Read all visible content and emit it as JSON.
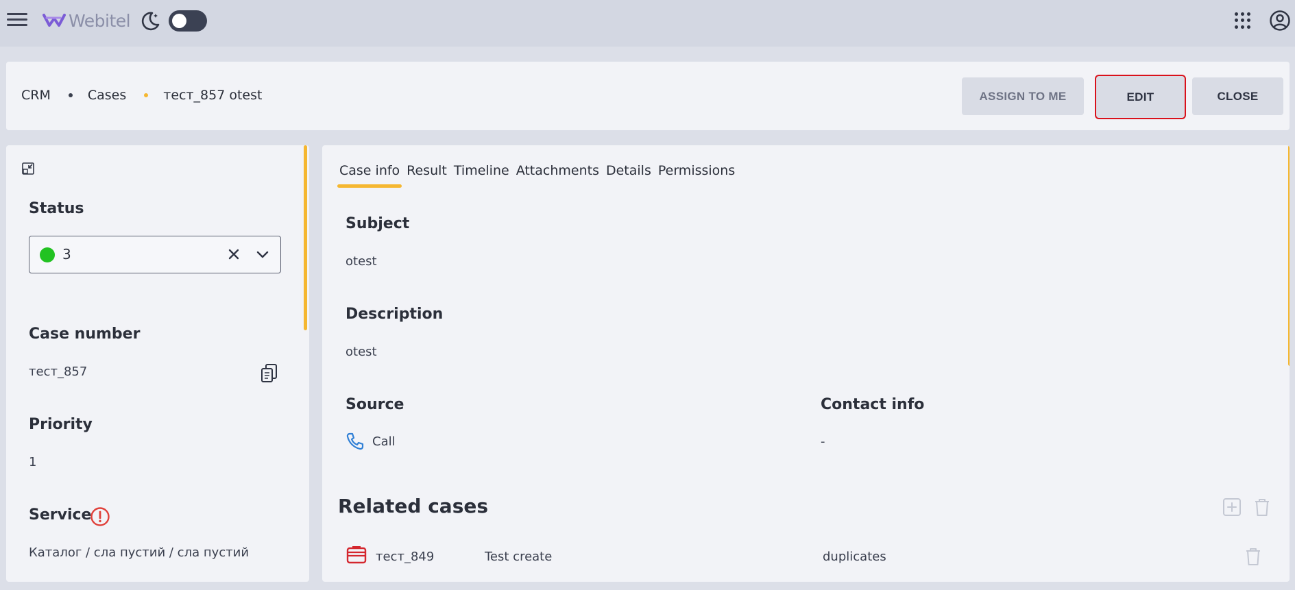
{
  "app": {
    "logo_text": "Webitel",
    "brand_color": "#7b5cd6",
    "accent_color": "#f5b731"
  },
  "header": {
    "breadcrumb": [
      "CRM",
      "Cases",
      "тест_857 otest"
    ],
    "assign_label": "ASSIGN TO ME",
    "edit_label": "EDIT",
    "close_label": "CLOSE"
  },
  "sidebar": {
    "status_label": "Status",
    "status_value": "3",
    "status_color": "#22c222",
    "case_number_label": "Case number",
    "case_number_value": "тест_857",
    "priority_label": "Priority",
    "priority_value": "1",
    "service_label": "Service",
    "service_value": "Каталог / сла пустий / сла пустий"
  },
  "main": {
    "tabs": [
      {
        "label": "Case info",
        "active": true
      },
      {
        "label": "Result",
        "active": false
      },
      {
        "label": "Timeline",
        "active": false
      },
      {
        "label": "Attachments",
        "active": false
      },
      {
        "label": "Details",
        "active": false
      },
      {
        "label": "Permissions",
        "active": false
      }
    ],
    "subject_label": "Subject",
    "subject_value": "otest",
    "description_label": "Description",
    "description_value": "otest",
    "source_label": "Source",
    "source_value": "Call",
    "contact_label": "Contact info",
    "contact_value": "-",
    "related_title": "Related cases",
    "related_rows": [
      {
        "number": "тест_849",
        "subject": "Test create",
        "relation": "duplicates"
      }
    ]
  }
}
